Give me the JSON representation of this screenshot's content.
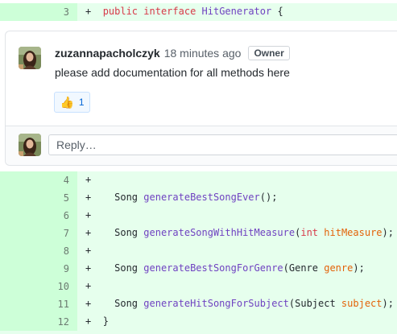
{
  "diff_top": {
    "line_number": "3",
    "marker": "+",
    "tokens": [
      {
        "text": "public ",
        "cls": "kw"
      },
      {
        "text": "interface ",
        "cls": "kw"
      },
      {
        "text": "HitGenerator",
        "cls": "fn"
      },
      {
        "text": " {",
        "cls": ""
      }
    ]
  },
  "comment": {
    "author": "zuzannapacholczyk",
    "time": "18 minutes ago",
    "badge": "Owner",
    "body": "please add documentation for all methods here",
    "reaction": {
      "icon": "thumbs-up-icon",
      "emoji": "👍",
      "count": "1"
    }
  },
  "reply": {
    "placeholder": "Reply…"
  },
  "diff_lines": [
    {
      "num": "4",
      "marker": "+",
      "tokens": []
    },
    {
      "num": "5",
      "marker": "+",
      "tokens": [
        {
          "text": "  Song ",
          "cls": ""
        },
        {
          "text": "generateBestSongEver",
          "cls": "fn"
        },
        {
          "text": "();",
          "cls": ""
        }
      ]
    },
    {
      "num": "6",
      "marker": "+",
      "tokens": []
    },
    {
      "num": "7",
      "marker": "+",
      "tokens": [
        {
          "text": "  Song ",
          "cls": ""
        },
        {
          "text": "generateSongWithHitMeasure",
          "cls": "fn"
        },
        {
          "text": "(",
          "cls": ""
        },
        {
          "text": "int",
          "cls": "kw"
        },
        {
          "text": " ",
          "cls": ""
        },
        {
          "text": "hitMeasure",
          "cls": "param"
        },
        {
          "text": ");",
          "cls": ""
        }
      ]
    },
    {
      "num": "8",
      "marker": "+",
      "tokens": []
    },
    {
      "num": "9",
      "marker": "+",
      "tokens": [
        {
          "text": "  Song ",
          "cls": ""
        },
        {
          "text": "generateBestSongForGenre",
          "cls": "fn"
        },
        {
          "text": "(Genre ",
          "cls": ""
        },
        {
          "text": "genre",
          "cls": "param"
        },
        {
          "text": ");",
          "cls": ""
        }
      ]
    },
    {
      "num": "10",
      "marker": "+",
      "tokens": []
    },
    {
      "num": "11",
      "marker": "+",
      "tokens": [
        {
          "text": "  Song ",
          "cls": ""
        },
        {
          "text": "generateHitSongForSubject",
          "cls": "fn"
        },
        {
          "text": "(Subject ",
          "cls": ""
        },
        {
          "text": "subject",
          "cls": "param"
        },
        {
          "text": ");",
          "cls": ""
        }
      ]
    },
    {
      "num": "12",
      "marker": "+",
      "tokens": [
        {
          "text": "}",
          "cls": ""
        }
      ]
    }
  ],
  "colors": {
    "addition_bg": "#e6ffed",
    "addition_gutter": "#cdffd8",
    "keyword": "#d73a49",
    "function": "#6f42c1",
    "parameter": "#e36209",
    "link": "#0366d6"
  }
}
